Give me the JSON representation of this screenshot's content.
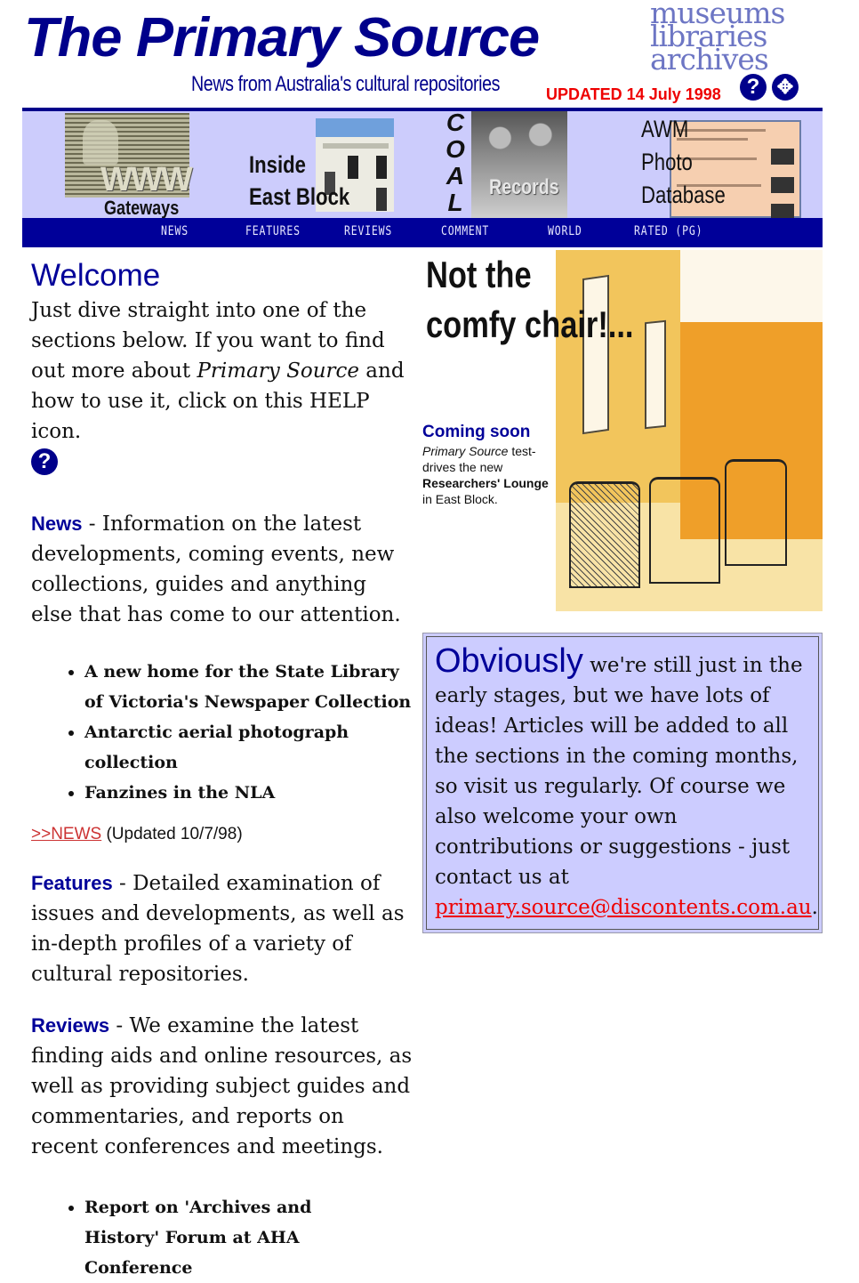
{
  "masthead": {
    "title": "The Primary Source",
    "subtitle": "News from Australia's cultural repositories",
    "updated": "UPDATED 14 July 1998",
    "tagline_lines": [
      "museums",
      "libraries",
      "archives"
    ],
    "icons": {
      "help": "?",
      "navigate": "✥"
    }
  },
  "banner": {
    "gateways": {
      "overlay": "WWW",
      "label": "Gateways"
    },
    "east_block": {
      "line1": "Inside",
      "line2": "East Block"
    },
    "coal": {
      "vertical": [
        "C",
        "O",
        "A",
        "L"
      ],
      "overlay": "Records"
    },
    "awm": {
      "lines": [
        "AWM",
        "Photo",
        "Database"
      ]
    }
  },
  "nav": [
    "NEWS",
    "FEATURES",
    "REVIEWS",
    "COMMENT",
    "WORLD",
    "RATED (PG)"
  ],
  "welcome": {
    "heading": "Welcome",
    "intro_part1": "Just dive straight into one of the sections below. If you want to find out more about ",
    "intro_italic": "Primary Source",
    "intro_part2": " and how to use it, click on this HELP icon.",
    "help_icon": "?"
  },
  "sections": {
    "news": {
      "label": "News",
      "text": " - Information on the latest developments, coming events, new collections, guides and anything else that has come to our attention.",
      "items": [
        "A new home for the State Library of Victoria's Newspaper Collection",
        "Antarctic aerial photograph collection",
        "Fanzines in the NLA"
      ],
      "link_label": ">>NEWS",
      "link_note": " (Updated 10/7/98)"
    },
    "features": {
      "label": "Features",
      "text": " - Detailed examination of issues and developments, as well as in-depth profiles of a variety of cultural repositories."
    },
    "reviews": {
      "label": "Reviews",
      "text": " - We examine the latest finding aids and online resources, as well as providing subject guides and commentaries, and reports on recent conferences and meetings.",
      "items": [
        "Report on 'Archives and History' Forum at AHA Conference"
      ]
    }
  },
  "promo": {
    "headline_line1": "Not the",
    "headline_line2": "comfy chair!...",
    "coming_title": "Coming soon",
    "body_italic": "Primary Source",
    "body_part1": " test-drives the new ",
    "body_bold": "Researchers' Lounge",
    "body_part2": "in East Block."
  },
  "notice": {
    "lead": "Obviously",
    "text": " we're still just in the early stages, but we have lots of ideas! Articles will be added to all the sections in the coming months, so visit us regularly. Of course we also welcome your own contributions or suggestions - just contact us at ",
    "email": "primary.source@discontents.com.au",
    "end": "."
  },
  "colors": {
    "brand_blue": "#000099",
    "banner_bg": "#ccccfc",
    "updated_red": "#ee0000",
    "link_red": "#cc3333"
  }
}
